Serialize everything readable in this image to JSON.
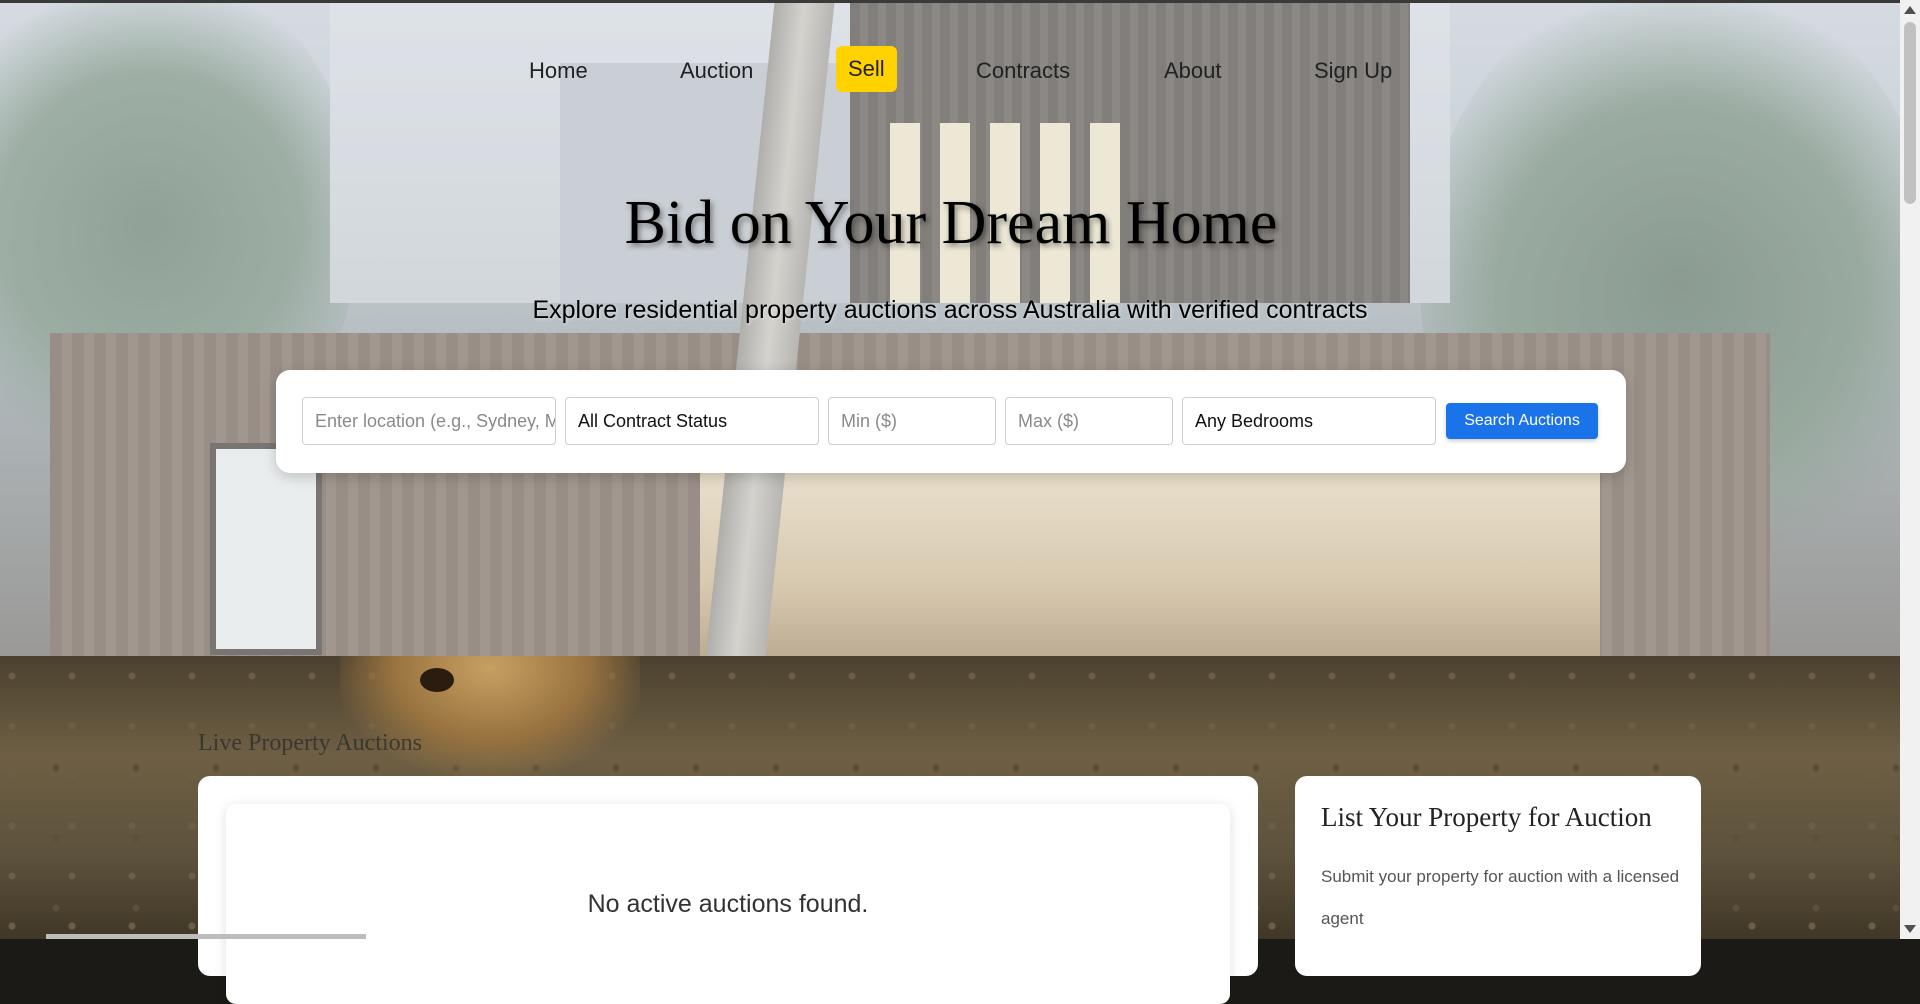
{
  "nav": {
    "items": [
      {
        "label": "Home",
        "active": false
      },
      {
        "label": "Auction",
        "active": false
      },
      {
        "label": "Sell",
        "active": true
      },
      {
        "label": "Contracts",
        "active": false
      },
      {
        "label": "About",
        "active": false
      },
      {
        "label": "Sign Up",
        "active": false
      }
    ],
    "active_color": "#ffd200"
  },
  "hero": {
    "title": "Bid on Your Dream Home",
    "subtitle": "Explore residential property auctions across Australia with verified contracts"
  },
  "search": {
    "location_placeholder": "Enter location (e.g., Sydney, Melbourne)",
    "contract_status_selected": "All Contract Status",
    "min_placeholder": "Min ($)",
    "max_placeholder": "Max ($)",
    "bedrooms_selected": "Any Bedrooms",
    "button_label": "Search Auctions",
    "button_color": "#1a73e8"
  },
  "main": {
    "section_title": "Live Property Auctions",
    "empty_message": "No active auctions found."
  },
  "sidebar": {
    "title": "List Your Property for Auction",
    "description": "Submit your property for auction with a licensed agent"
  }
}
